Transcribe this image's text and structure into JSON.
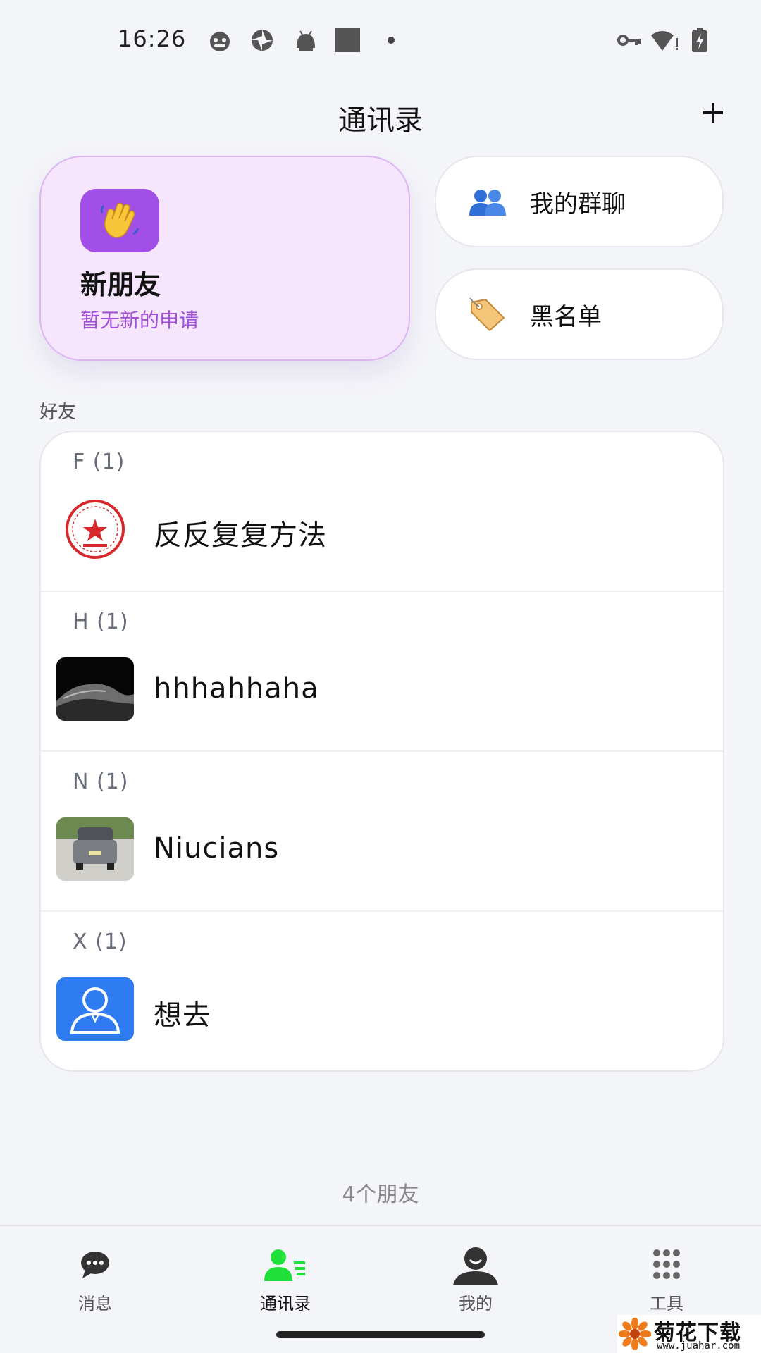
{
  "status_bar": {
    "time": "16:26",
    "left_icons": [
      "cat-face-icon",
      "aperture-icon",
      "android-icon",
      "square-icon",
      "dot-icon"
    ],
    "right_icons": [
      "vpn-key-icon",
      "wifi-alert-icon",
      "battery-charging-icon"
    ]
  },
  "header": {
    "title": "通讯录",
    "add_icon": "plus-icon"
  },
  "new_friend": {
    "title": "新朋友",
    "subtitle": "暂无新的申请",
    "icon": "waving-hand-icon",
    "icon_bg": "#a24fe8"
  },
  "shortcuts": {
    "groups_label": "我的群聊",
    "groups_icon": "two-people-icon",
    "blacklist_label": "黑名单",
    "blacklist_icon": "tag-icon"
  },
  "friends_section_label": "好友",
  "friend_groups": [
    {
      "letter": "F (1)",
      "contacts": [
        {
          "name": "反反复复方法",
          "avatar": "red-seal-avatar"
        }
      ]
    },
    {
      "letter": "H (1)",
      "contacts": [
        {
          "name": "hhhahhaha",
          "avatar": "dark-landscape-avatar"
        }
      ]
    },
    {
      "letter": "N (1)",
      "contacts": [
        {
          "name": "Niucians",
          "avatar": "car-photo-avatar"
        }
      ]
    },
    {
      "letter": "X (1)",
      "contacts": [
        {
          "name": "想去",
          "avatar": "default-person-avatar"
        }
      ]
    }
  ],
  "friend_count": "4个朋友",
  "bottom_nav": {
    "items": [
      {
        "label": "消息",
        "icon": "chat-bubble-icon"
      },
      {
        "label": "通讯录",
        "icon": "contacts-icon",
        "active": true
      },
      {
        "label": "我的",
        "icon": "profile-icon"
      },
      {
        "label": "工具",
        "icon": "grid-dots-icon"
      }
    ]
  },
  "colors": {
    "accent_purple": "#a24fe8",
    "active_tab": "#22e03a",
    "default_avatar_blue": "#2f7cf2"
  },
  "watermark": {
    "title": "菊花下载网",
    "url": "www.juahar.com"
  }
}
